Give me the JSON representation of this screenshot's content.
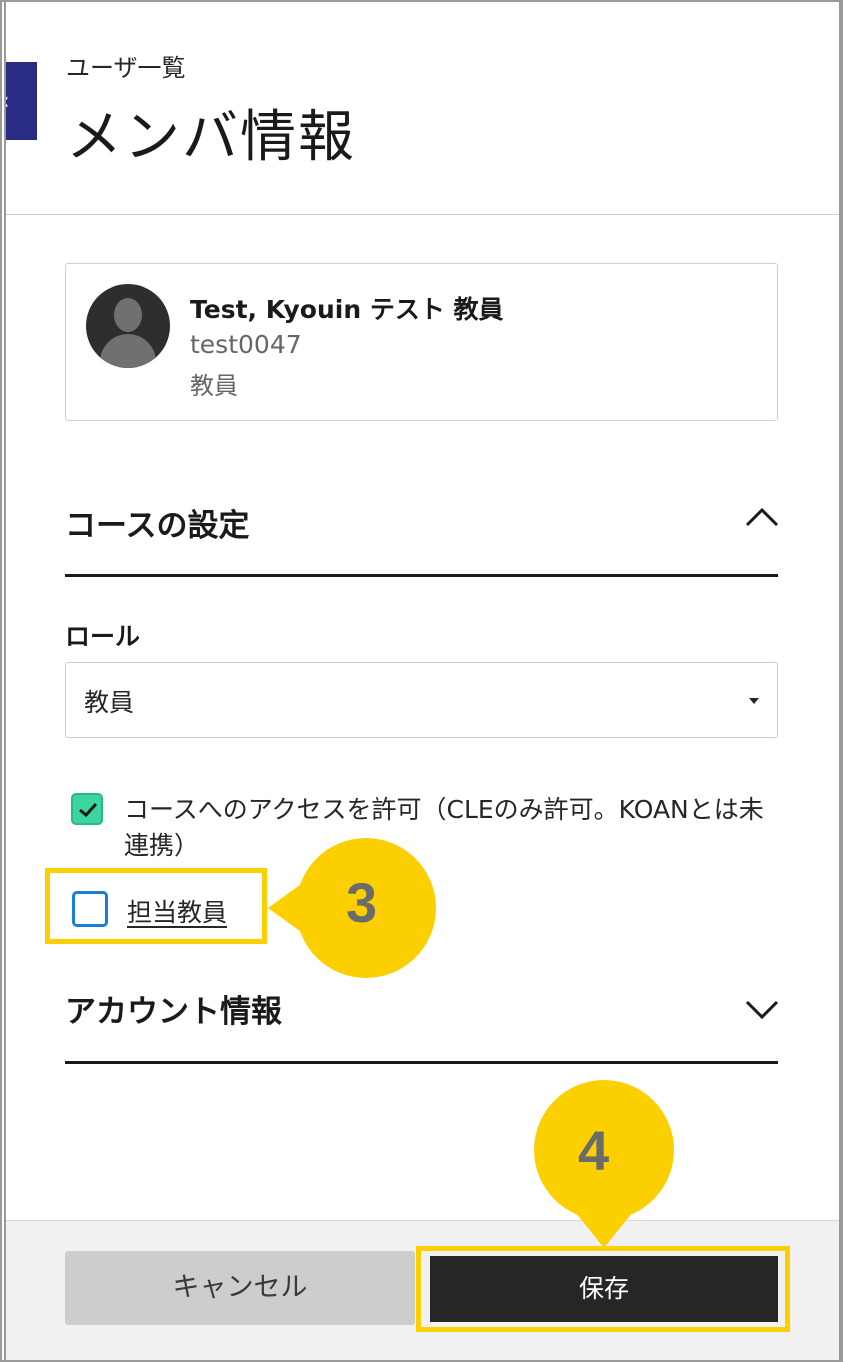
{
  "header": {
    "back_icon": "chevron-left-icon",
    "back_glyph": "‹",
    "breadcrumb": "ユーザ一覧",
    "title": "メンバ情報"
  },
  "user": {
    "name": "Test, Kyouin テスト 教員",
    "id": "test0047",
    "role": "教員",
    "avatar_icon": "person-silhouette-icon"
  },
  "course_settings": {
    "title": "コースの設定",
    "expanded": true,
    "role_label": "ロール",
    "role_value": "教員",
    "access_checkbox": {
      "checked": true,
      "label": "コースへのアクセスを許可（CLEのみ許可。KOANとは未連携）"
    },
    "teacher_checkbox": {
      "checked": false,
      "label": "担当教員"
    }
  },
  "account_info": {
    "title": "アカウント情報",
    "expanded": false
  },
  "footer": {
    "cancel_label": "キャンセル",
    "save_label": "保存"
  },
  "callouts": [
    {
      "number": "3"
    },
    {
      "number": "4"
    }
  ],
  "colors": {
    "accent_yellow": "#fcd000",
    "check_green": "#3bd6a0",
    "checkbox_blue": "#1a7fd6",
    "back_tab": "#2a2b82",
    "save_bg": "#262626"
  }
}
